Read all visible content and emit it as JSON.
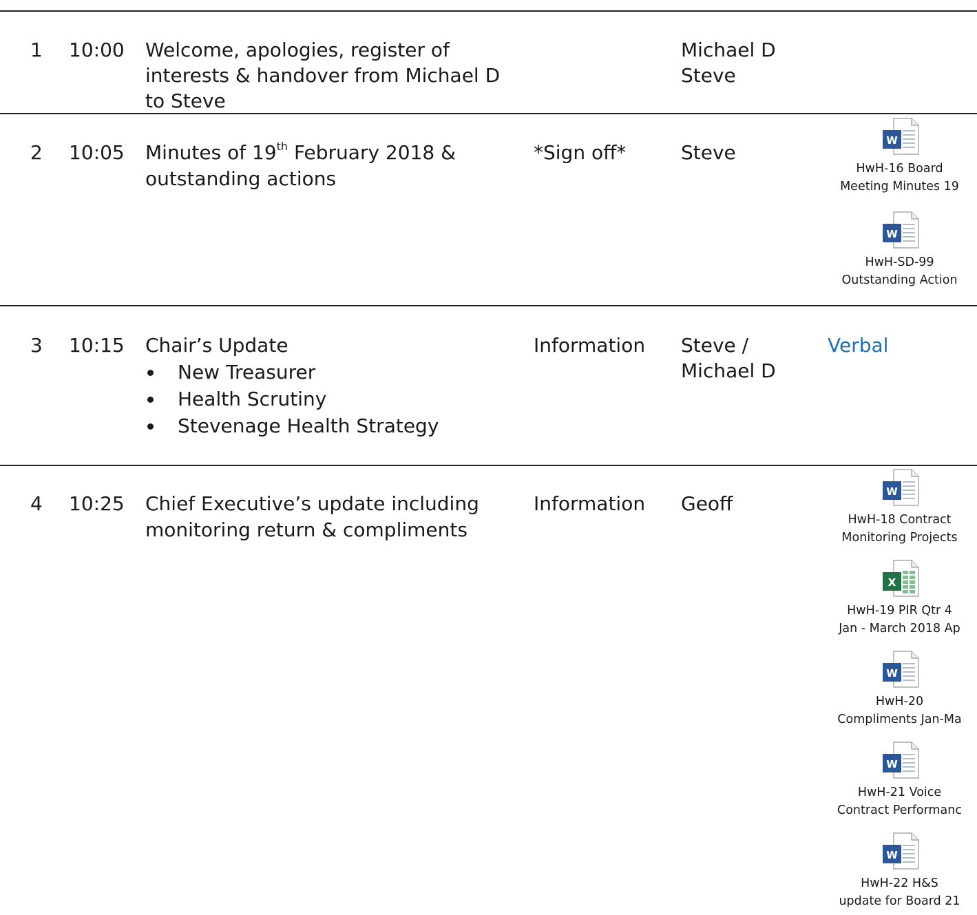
{
  "rows": [
    {
      "num": "1",
      "time": "10:00",
      "item_lines": [
        "Welcome, apologies, register of",
        "interests & handover from Michael D",
        "to Steve"
      ],
      "purpose": "",
      "lead_lines": [
        "Michael D",
        "Steve"
      ]
    },
    {
      "num": "2",
      "time": "10:05",
      "item_pre": "Minutes of 19",
      "item_sup": "th",
      "item_post": " February 2018 &",
      "item_line2": "outstanding actions",
      "purpose": "*Sign off*",
      "lead_lines": [
        "Steve"
      ],
      "attachments": [
        {
          "icon": "word-document-icon",
          "caption": [
            "HwH-16 Board",
            "Meeting Minutes 19"
          ]
        },
        {
          "icon": "word-document-icon",
          "caption": [
            "HwH-SD-99",
            "Outstanding Action"
          ]
        }
      ]
    },
    {
      "num": "3",
      "time": "10:15",
      "item_title": "Chair’s Update",
      "bullets": [
        "New Treasurer",
        "Health Scrutiny",
        "Stevenage Health Strategy"
      ],
      "purpose": "Information",
      "lead_lines": [
        "Steve /",
        "Michael D"
      ],
      "papers": "Verbal"
    },
    {
      "num": "4",
      "time": "10:25",
      "item_lines": [
        "Chief Executive’s update including",
        "monitoring return & compliments"
      ],
      "purpose": "Information",
      "lead_lines": [
        "Geoff"
      ],
      "attachments": [
        {
          "icon": "word-document-icon",
          "caption": [
            "HwH-18 Contract",
            "Monitoring Projects"
          ]
        },
        {
          "icon": "excel-spreadsheet-icon",
          "caption": [
            "HwH-19 PIR Qtr 4",
            "Jan - March 2018 Ap"
          ]
        },
        {
          "icon": "word-document-icon",
          "caption": [
            "HwH-20",
            "Compliments Jan-Ma"
          ]
        },
        {
          "icon": "word-document-icon",
          "caption": [
            "HwH-21 Voice",
            "Contract Performanc"
          ]
        },
        {
          "icon": "word-document-icon",
          "caption": [
            "HwH-22 H&S",
            "update for Board 21"
          ]
        }
      ]
    }
  ],
  "colors": {
    "rule": "#222222",
    "link": "#1f6fb5",
    "word": "#2b579a",
    "excel": "#217346"
  }
}
